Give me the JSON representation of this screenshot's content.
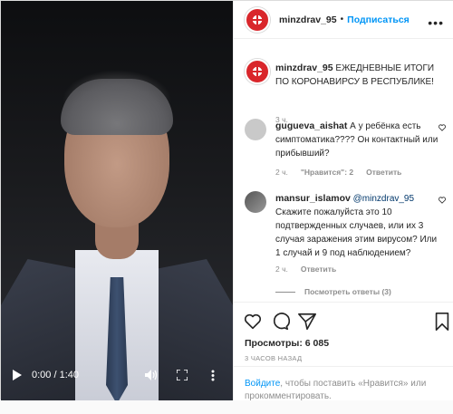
{
  "video": {
    "time": "0:00 / 1:40"
  },
  "header": {
    "username": "minzdrav_95",
    "separator": "•",
    "follow_label": "Подписаться",
    "more_label": "•••"
  },
  "caption": {
    "username": "minzdrav_95",
    "text": "ЕЖЕДНЕВНЫЕ ИТОГИ ПО КОРОНАВИРСУ В РЕСПУБЛИКЕ!",
    "time": "3 ч."
  },
  "comments": [
    {
      "username": "gugueva_aishat",
      "text": "А у ребёнка есть симптоматика???? Он контактный или прибывший?",
      "time": "2 ч.",
      "likes": "\"Нравится\": 2",
      "reply": "Ответить"
    },
    {
      "username": "mansur_islamov",
      "mention": "@minzdrav_95",
      "text": "Скажите пожалуйста это 10 подтвержденных случаев, или их 3 случая заражения этим вирусом? Или 1 случай и 9 под наблюдением?",
      "time": "2 ч.",
      "reply": "Ответить"
    }
  ],
  "view_replies": "Посмотреть ответы (3)",
  "actions": {
    "views": "Просмотры: 6 085",
    "posted": "3 ЧАСОВ НАЗАД"
  },
  "login": {
    "link": "Войдите",
    "rest": ", чтобы поставить «Нравится» или прокомментировать."
  }
}
